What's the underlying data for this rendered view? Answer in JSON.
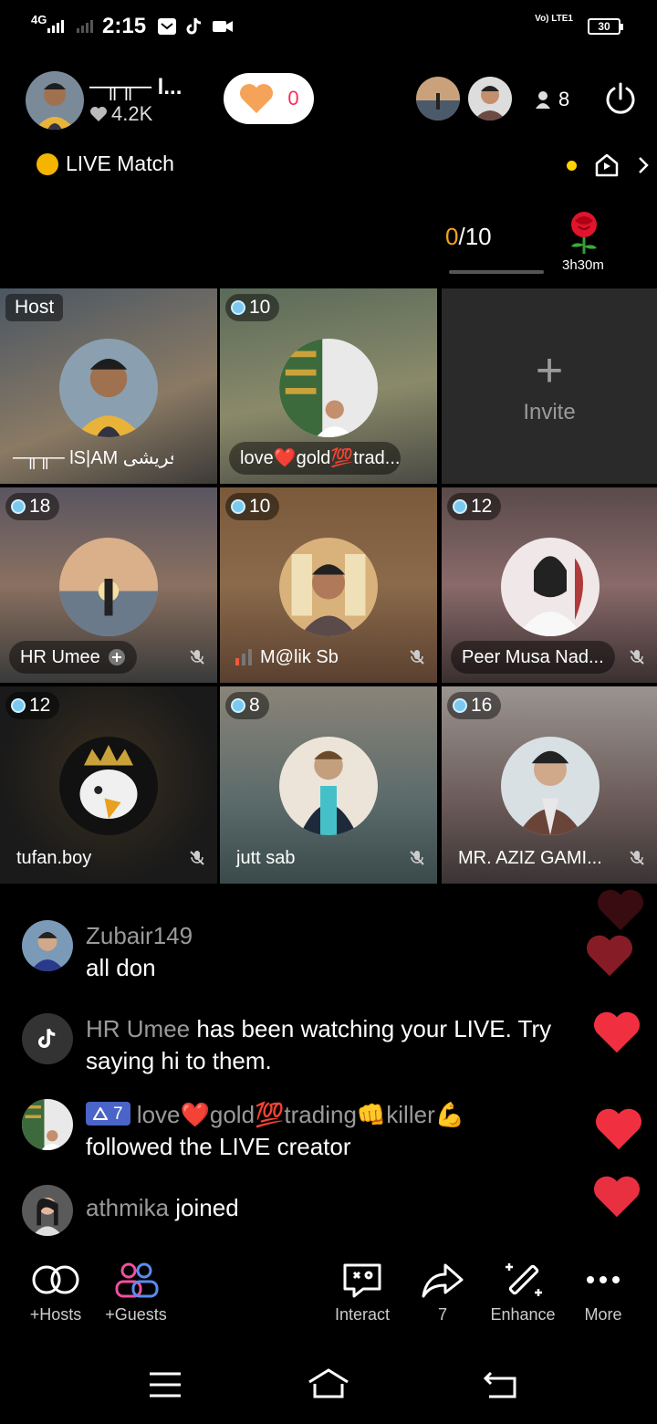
{
  "status_bar": {
    "network": "4G",
    "time": "2:15",
    "volte": "Vo) LTE1",
    "battery": "30",
    "icons": [
      "mail-icon",
      "tiktok-icon",
      "video-icon"
    ]
  },
  "header": {
    "host_name": "─╥╥─ l...",
    "host_likes": "4.2K",
    "heart_count": "0",
    "viewer_count": "8"
  },
  "live_match": {
    "label": "LIVE Match"
  },
  "match_progress": {
    "current": "0",
    "total": "/10",
    "timer": "3h30m"
  },
  "grid": {
    "host_tag": "Host",
    "invite_label": "Invite",
    "cells": [
      {
        "name": "─╥╥─ lS|AM قریشی ...",
        "badge": ""
      },
      {
        "name": "love❤️gold💯trad...",
        "badge": "10"
      },
      {
        "name": "HR Umee",
        "badge": "18"
      },
      {
        "name": "M@lik Sb",
        "badge": "10"
      },
      {
        "name": "Peer Musa Nad...",
        "badge": "12"
      },
      {
        "name": "tufan.boy",
        "badge": "12"
      },
      {
        "name": "jutt sab",
        "badge": "8"
      },
      {
        "name": "MR. AZIZ GAMI...",
        "badge": "16"
      }
    ]
  },
  "comments": [
    {
      "user": "Zubair149",
      "text": "all don"
    },
    {
      "user": "HR Umee",
      "text": " has been watching your LIVE. Try saying hi to them."
    },
    {
      "level": "7",
      "user": "love❤️gold💯trading👊killer💪",
      "text": "followed the LIVE creator"
    },
    {
      "user": "athmika",
      "text": " joined"
    }
  ],
  "toolbar": {
    "hosts": "+Hosts",
    "guests": "+Guests",
    "interact": "Interact",
    "share_count": "7",
    "enhance": "Enhance",
    "more": "More"
  },
  "colors": {
    "accent_red": "#fe2c55",
    "progress_orange": "#f7a21b",
    "selected_border": "#2fb5e8"
  }
}
